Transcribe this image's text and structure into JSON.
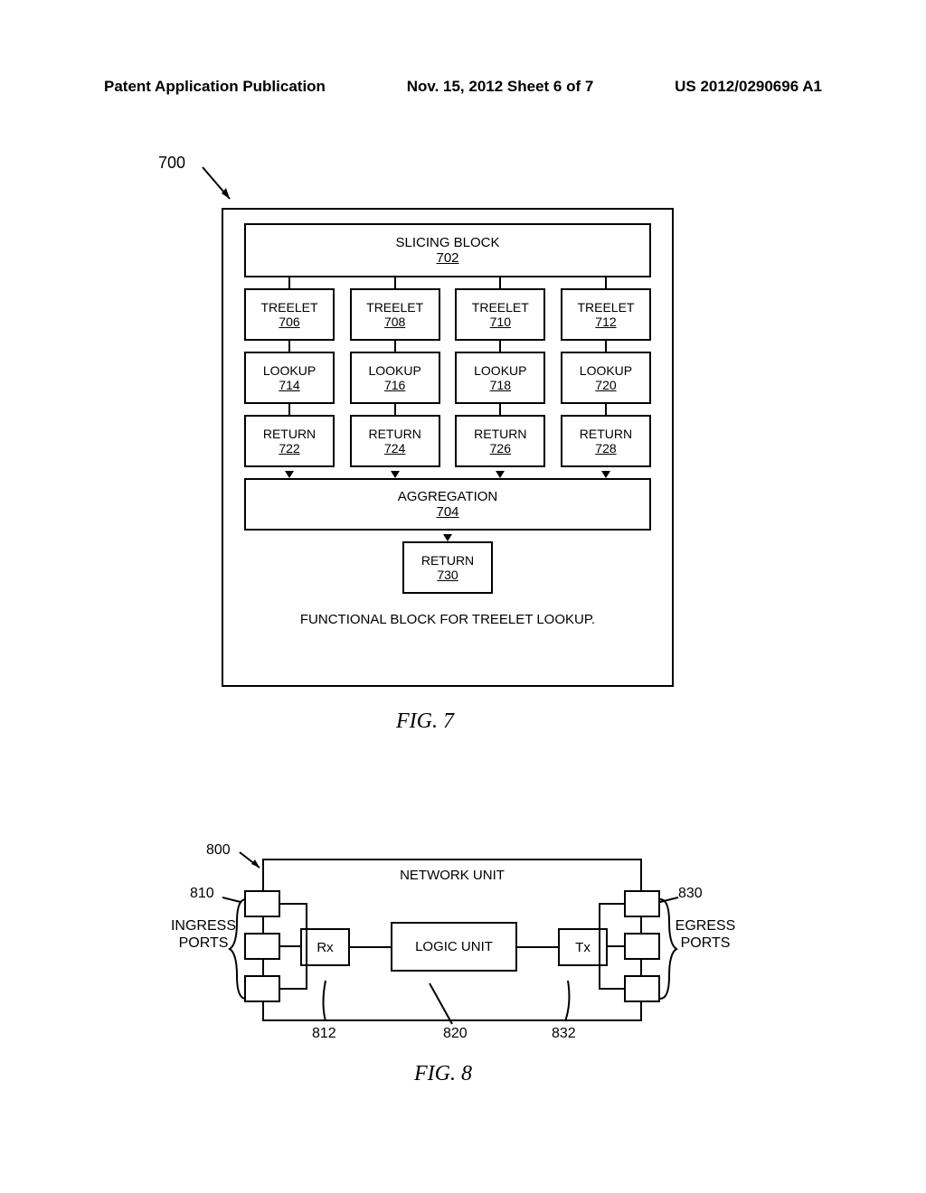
{
  "header": {
    "left": "Patent Application Publication",
    "center": "Nov. 15, 2012  Sheet 6 of 7",
    "right": "US 2012/0290696 A1"
  },
  "fig7": {
    "ref": "700",
    "slicing": {
      "label": "SLICING BLOCK",
      "num": "702"
    },
    "treelets": [
      {
        "label": "TREELET",
        "num": "706"
      },
      {
        "label": "TREELET",
        "num": "708"
      },
      {
        "label": "TREELET",
        "num": "710"
      },
      {
        "label": "TREELET",
        "num": "712"
      }
    ],
    "lookups": [
      {
        "label": "LOOKUP",
        "num": "714"
      },
      {
        "label": "LOOKUP",
        "num": "716"
      },
      {
        "label": "LOOKUP",
        "num": "718"
      },
      {
        "label": "LOOKUP",
        "num": "720"
      }
    ],
    "returns": [
      {
        "label": "RETURN",
        "num": "722"
      },
      {
        "label": "RETURN",
        "num": "724"
      },
      {
        "label": "RETURN",
        "num": "726"
      },
      {
        "label": "RETURN",
        "num": "728"
      }
    ],
    "aggregation": {
      "label": "AGGREGATION",
      "num": "704"
    },
    "final_return": {
      "label": "RETURN",
      "num": "730"
    },
    "caption": "FUNCTIONAL BLOCK FOR TREELET LOOKUP.",
    "fig_label": "FIG. 7"
  },
  "fig8": {
    "ref_800": "800",
    "ref_810": "810",
    "ref_812": "812",
    "ref_820": "820",
    "ref_830": "830",
    "ref_832": "832",
    "network_unit": "NETWORK UNIT",
    "rx": "Rx",
    "logic": "LOGIC UNIT",
    "tx": "Tx",
    "ingress": "INGRESS PORTS",
    "egress": "EGRESS PORTS",
    "fig_label": "FIG. 8"
  }
}
